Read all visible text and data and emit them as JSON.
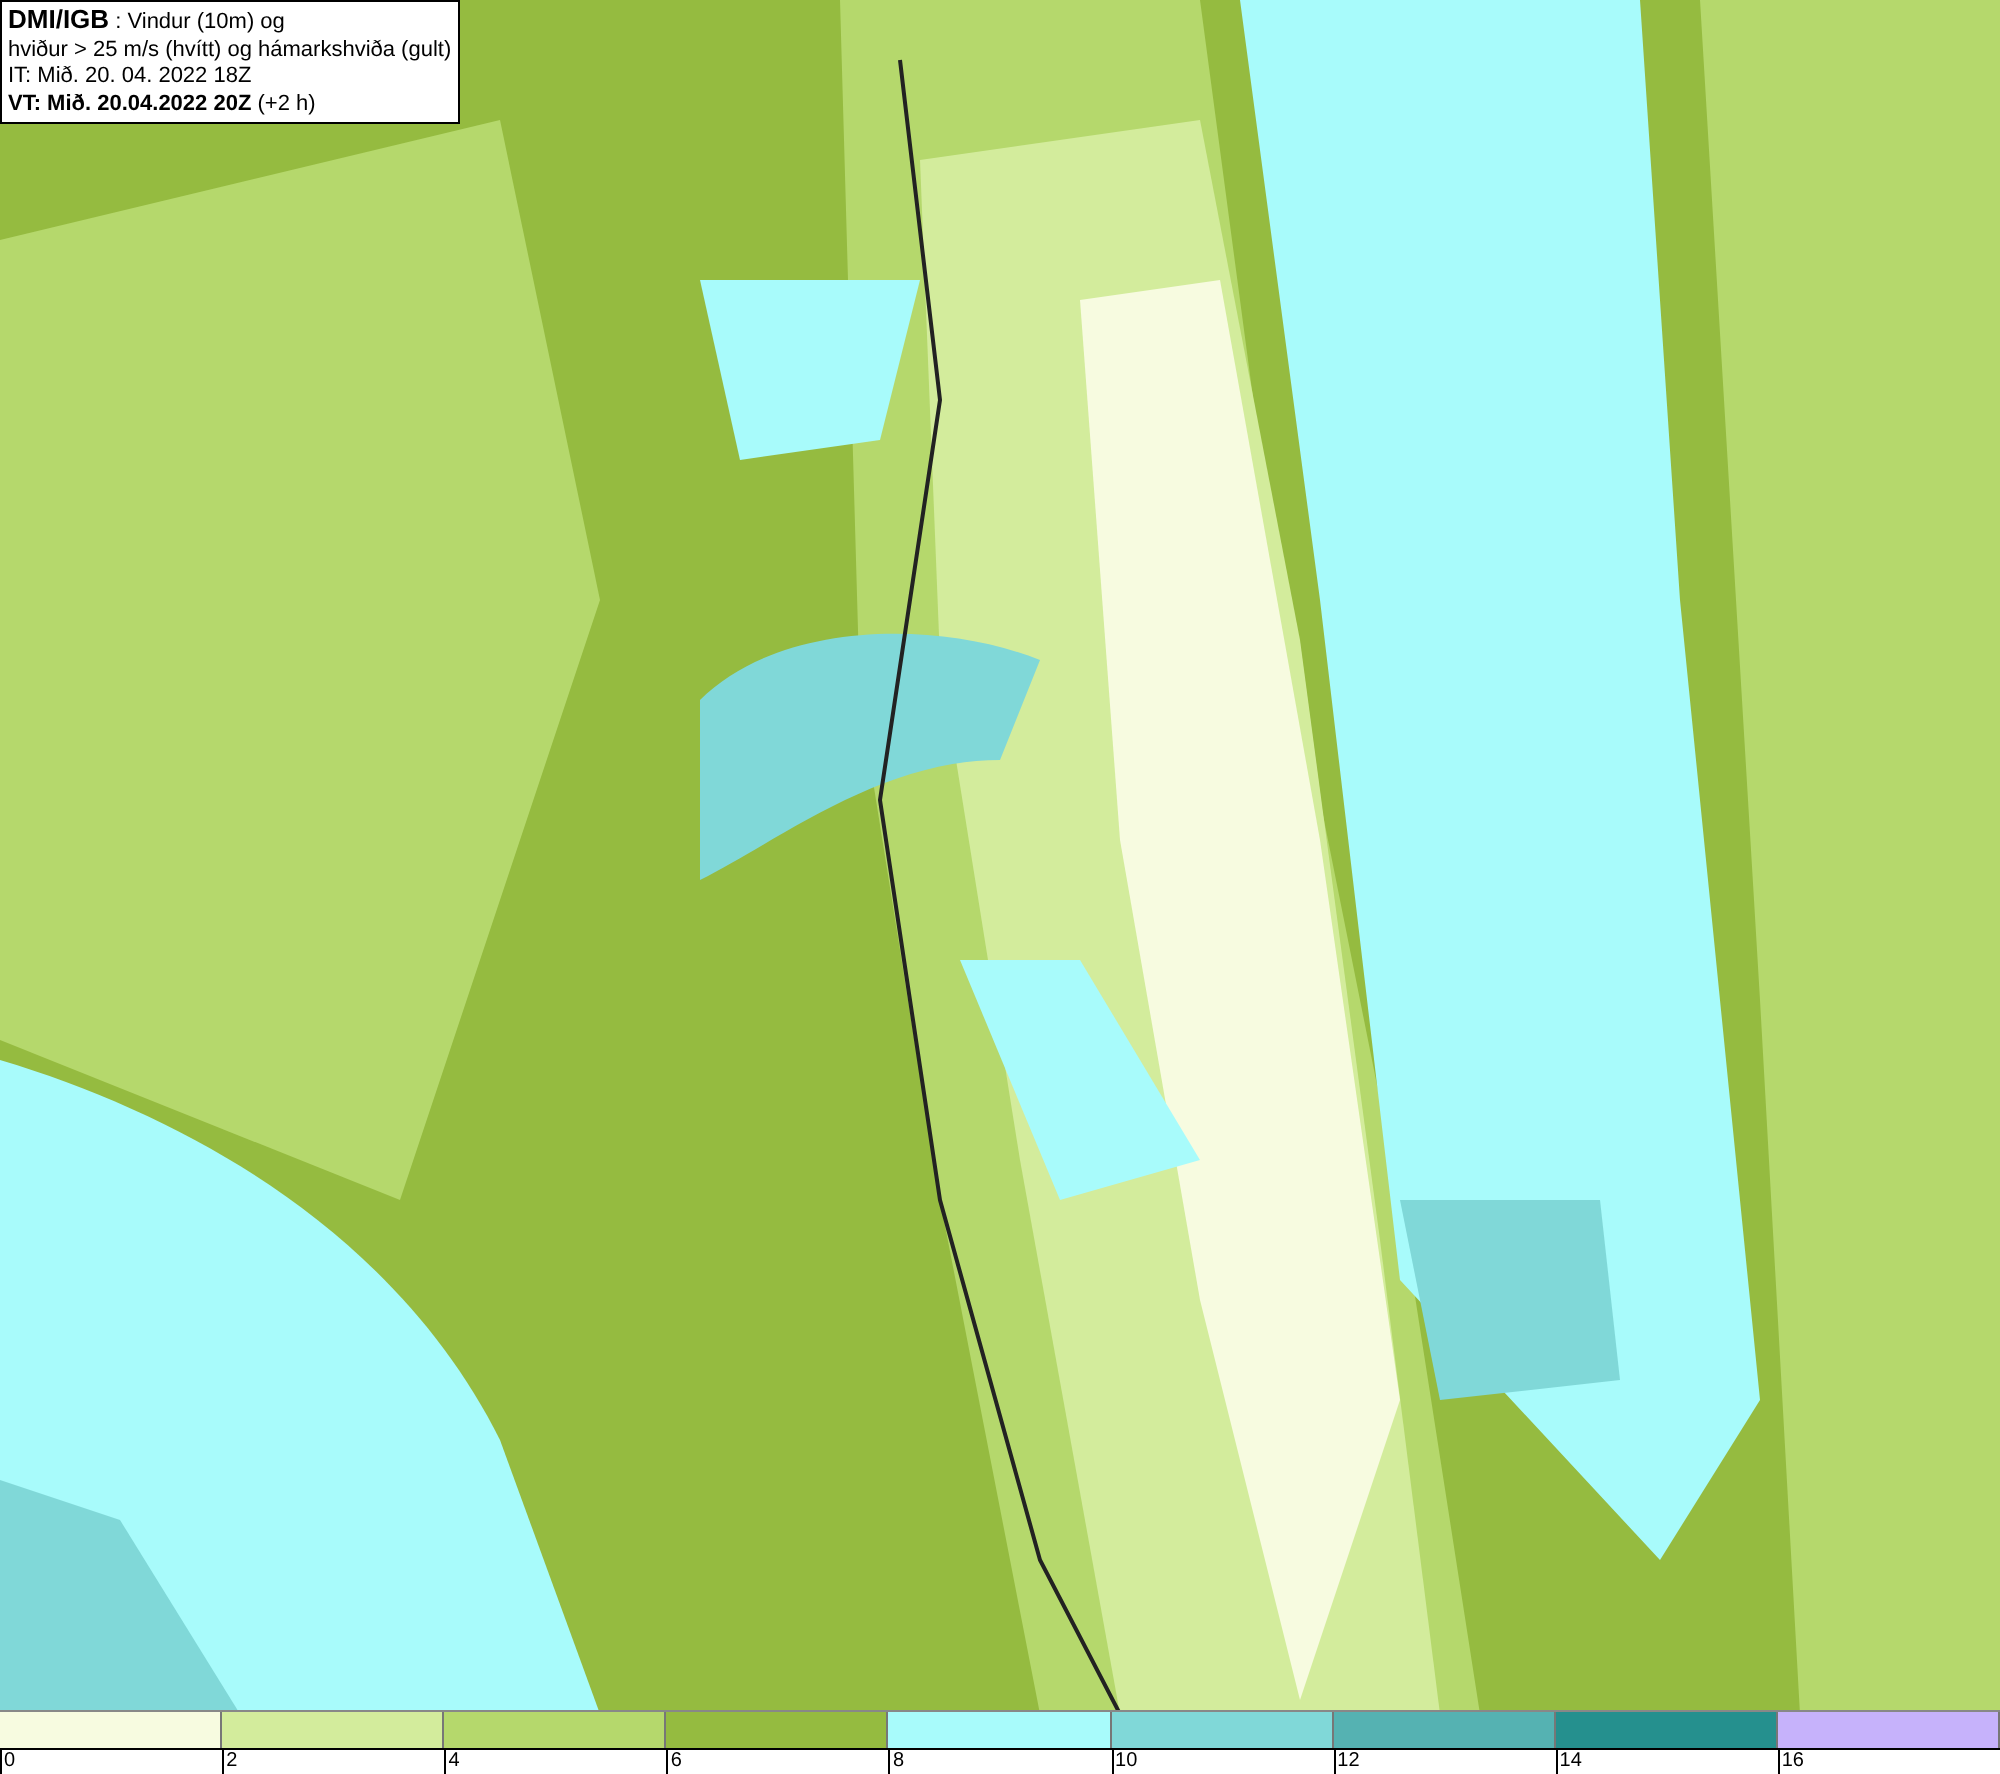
{
  "info_box": {
    "lines": [
      "**DMI/IGB** : Vindur (10m) og",
      "hviður > 25 m/s (hvítt) og hámarkshviða (gult)",
      "IT: Mið. 20. 04. 2022 18Z",
      "**VT: Mið. 20.04.2022 20Z** (+2 h)"
    ]
  },
  "legend": {
    "bins": [
      {
        "color": "#f7fbe0"
      },
      {
        "color": "#d3ec9c"
      },
      {
        "color": "#b5d86c"
      },
      {
        "color": "#95bb40"
      },
      {
        "color": "#a8fbfb"
      },
      {
        "color": "#80d8d8"
      },
      {
        "color": "#55b2b2"
      },
      {
        "color": "#25908e"
      },
      {
        "color": "#c6b2fb"
      }
    ],
    "ticks": [
      "0",
      "2",
      "4",
      "6",
      "8",
      "10",
      "12",
      "14",
      "16"
    ]
  }
}
